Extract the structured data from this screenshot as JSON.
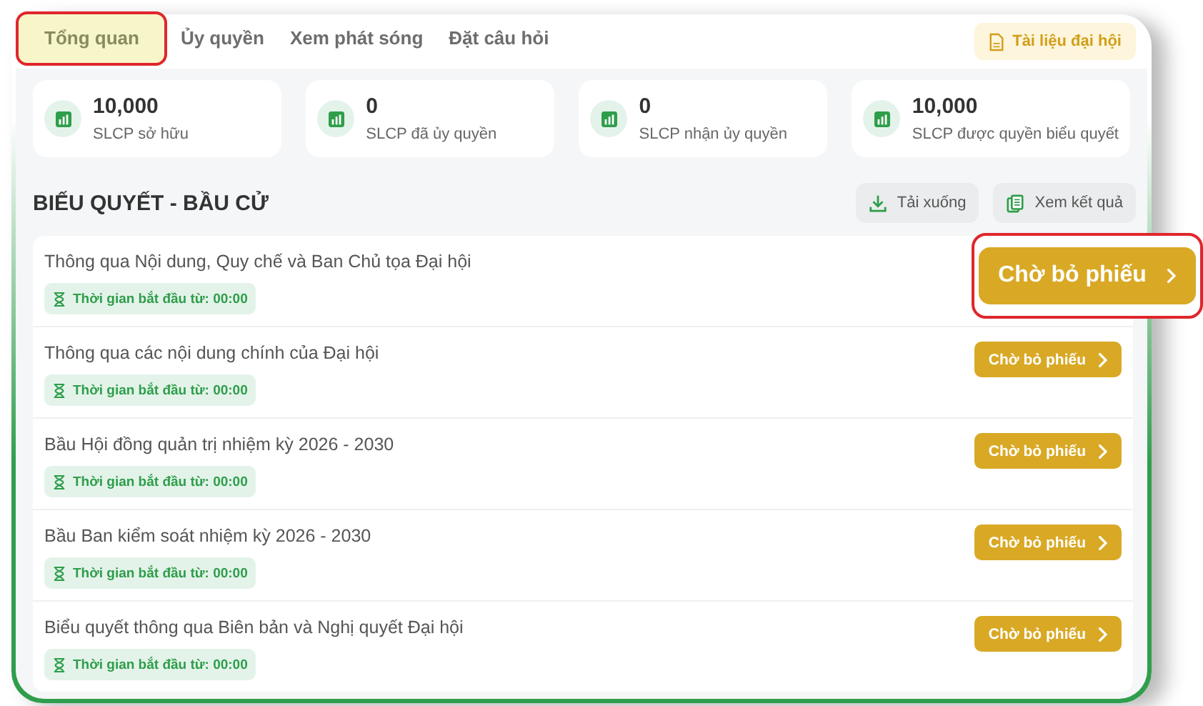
{
  "tabs": [
    {
      "label": "Tổng quan",
      "selected": true,
      "highlighted": true
    },
    {
      "label": "Ủy quyền",
      "selected": false,
      "highlighted": false
    },
    {
      "label": "Xem phát sóng",
      "selected": false,
      "highlighted": false
    },
    {
      "label": "Đặt câu hỏi",
      "selected": false,
      "highlighted": false
    }
  ],
  "documents_button": {
    "label": "Tài liệu đại hội"
  },
  "stats": [
    {
      "value": "10,000",
      "label": "SLCP sở hữu"
    },
    {
      "value": "0",
      "label": "SLCP đã ủy quyền"
    },
    {
      "value": "0",
      "label": "SLCP nhận ủy quyền"
    },
    {
      "value": "10,000",
      "label": "SLCP được quyền biểu quyết"
    }
  ],
  "section": {
    "title": "BIẾU QUYẾT - BẦU CỬ",
    "actions": [
      {
        "label": "Tải xuống",
        "kind": "download"
      },
      {
        "label": "Xem kết quả",
        "kind": "results"
      }
    ]
  },
  "items": [
    {
      "title": "Thông qua Nội dung, Quy chế và Ban Chủ tọa Đại hội",
      "time": "Thời gian bắt đầu từ: 00:00",
      "button": "Chờ bỏ phiếu",
      "highlighted": true
    },
    {
      "title": "Thông qua các nội dung chính của Đại hội",
      "time": "Thời gian bắt đầu từ: 00:00",
      "button": "Chờ bỏ phiếu",
      "highlighted": false
    },
    {
      "title": "Bầu Hội đồng quản trị nhiệm kỳ 2026 - 2030",
      "time": "Thời gian bắt đầu từ: 00:00",
      "button": "Chờ bỏ phiếu",
      "highlighted": false
    },
    {
      "title": "Bầu Ban kiểm soát nhiệm kỳ 2026 - 2030",
      "time": "Thời gian bắt đầu từ: 00:00",
      "button": "Chờ bỏ phiếu",
      "highlighted": false
    },
    {
      "title": "Biểu quyết thông qua Biên bản và Nghị quyết Đại hội",
      "time": "Thời gian bắt đầu từ: 00:00",
      "button": "Chờ bỏ phiếu",
      "highlighted": false
    }
  ]
}
